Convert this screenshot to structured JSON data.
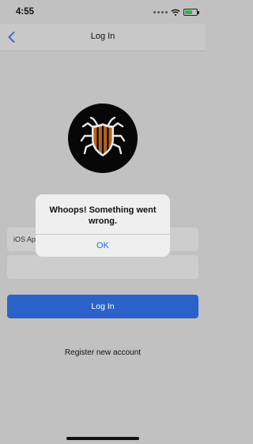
{
  "status_bar": {
    "time": "4:55"
  },
  "nav": {
    "title": "Log In"
  },
  "form": {
    "username_value": "iOS Ap",
    "password_value": "",
    "login_label": "Log In",
    "register_label": "Register new account"
  },
  "alert": {
    "message": "Whoops! Something went wrong.",
    "ok_label": "OK"
  },
  "colors": {
    "accent": "#2a62c9",
    "alert_link": "#1a6fe0",
    "logo_bg": "#070707",
    "shield_stripe": "#b8621f"
  }
}
